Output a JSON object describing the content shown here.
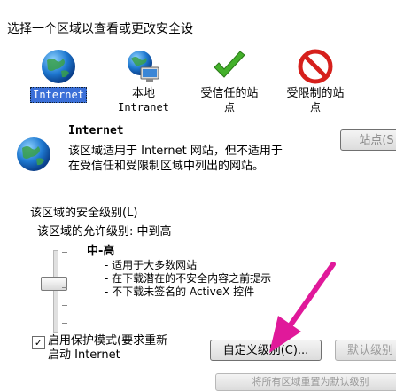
{
  "zones": {
    "prompt": "选择一个区域以查看或更改安全设",
    "items": [
      {
        "label": "Internet",
        "sub": "",
        "icon": "globe-icon"
      },
      {
        "label": "本地",
        "sub": "Intranet",
        "icon": "local-intranet-icon"
      },
      {
        "label": "受信任的站",
        "sub": "点",
        "icon": "trusted-check-icon"
      },
      {
        "label": "受限制的站",
        "sub": "点",
        "icon": "restricted-no-icon"
      }
    ]
  },
  "zone_info": {
    "name": "Internet",
    "sites_button": "站点(S",
    "description_line1": "该区域适用于 Internet 网站，但不适用于",
    "description_line2": "在受信任和受限制区域中列出的网站。"
  },
  "security": {
    "title": "该区域的安全级别(L)",
    "allowed_levels": "该区域的允许级别: 中到高",
    "level_name": "中-高",
    "bullets": [
      "- 适用于大多数网站",
      "- 在下载潜在的不安全内容之前提示",
      "- 不下载未签名的 ActiveX 控件"
    ],
    "protected_mode_checked": true,
    "protected_mode_line1": "启用保护模式(要求重新",
    "protected_mode_line2": "启动 Internet",
    "custom_level_button": "自定义级别(C)...",
    "default_level_button": "默认级别",
    "reset_all_button": "将所有区域重置为默认级别"
  },
  "colors": {
    "selection": "#3a6fd8",
    "arrow": "#e0199a"
  }
}
